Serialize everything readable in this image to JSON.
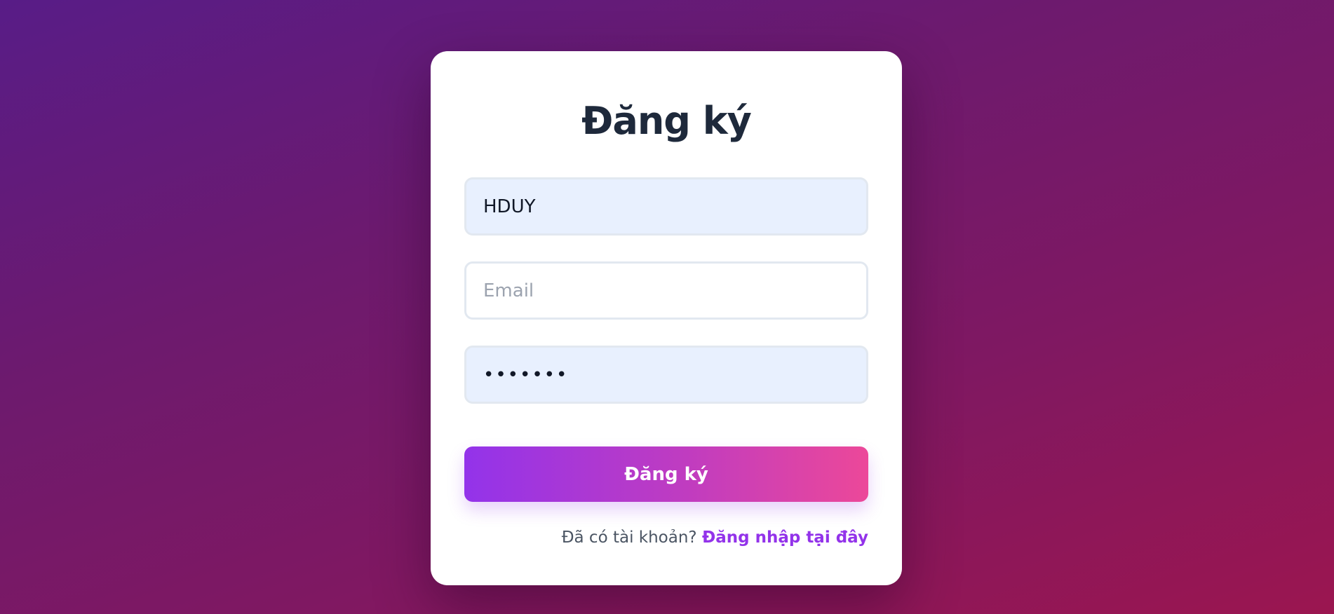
{
  "form": {
    "title": "Đăng ký",
    "username": {
      "value": "HDUY",
      "placeholder": ""
    },
    "email": {
      "value": "",
      "placeholder": "Email"
    },
    "password": {
      "value": "•••••••",
      "placeholder": ""
    },
    "submit_label": "Đăng ký",
    "footer_text": "Đã có tài khoản?",
    "login_link": "Đăng nhập tại đây"
  },
  "colors": {
    "accent": "#9333ea",
    "accent_end": "#ec4899",
    "autofill_bg": "#e8f0fe",
    "title": "#1e293b"
  }
}
